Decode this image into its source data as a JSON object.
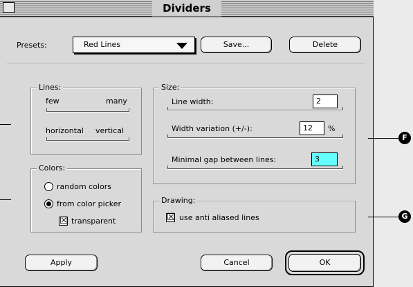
{
  "window": {
    "title": "Dividers"
  },
  "presets": {
    "label": "Presets:",
    "selected": "Red Lines",
    "save_label": "Save...",
    "delete_label": "Delete"
  },
  "lines": {
    "title": "Lines:",
    "few_label": "few",
    "many_label": "many",
    "horizontal_label": "horizontal",
    "vertical_label": "vertical",
    "count_level": 0.5,
    "orientation_level": 0.5
  },
  "colors": {
    "title": "Colors:",
    "random_label": "random colors",
    "picker_label": "from color picker",
    "transparent_label": "transparent",
    "selected": "from color picker",
    "transparent_checked": true
  },
  "size": {
    "title": "Size:",
    "line_width_label": "Line width:",
    "line_width_value": "2",
    "width_variation_label": "Width variation (+/-):",
    "width_variation_value": "12",
    "width_variation_unit": "%",
    "min_gap_label": "Minimal gap between lines:",
    "min_gap_value": "3",
    "min_gap_highlight": "#66ffff"
  },
  "drawing": {
    "title": "Drawing:",
    "anti_alias_label": "use anti aliased lines",
    "anti_alias_checked": true
  },
  "footer": {
    "apply_label": "Apply",
    "cancel_label": "Cancel",
    "ok_label": "OK"
  },
  "callouts": {
    "f": "F",
    "g": "G"
  }
}
